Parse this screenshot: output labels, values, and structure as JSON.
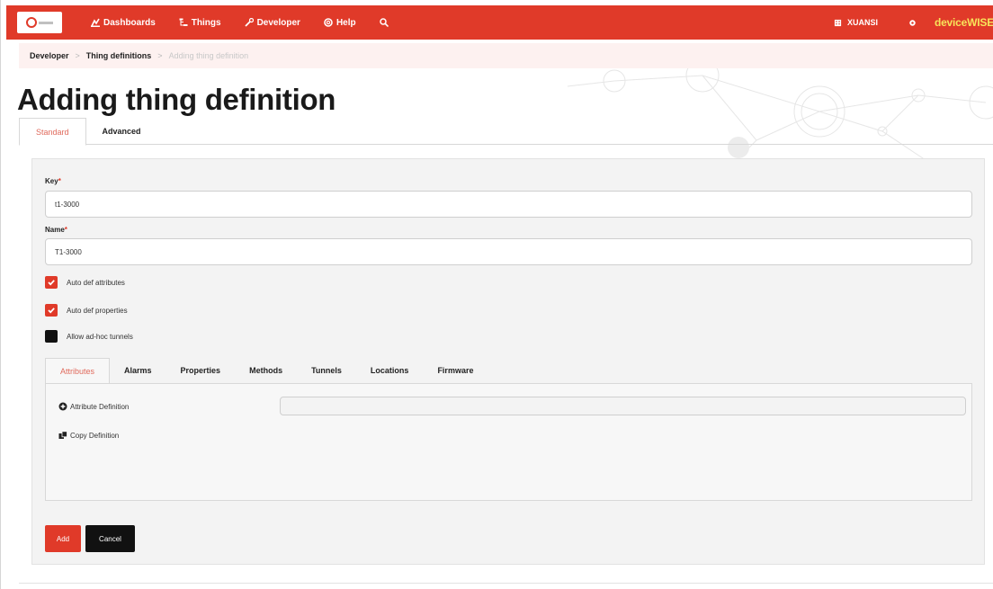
{
  "nav": {
    "items": [
      {
        "label": "Dashboards",
        "icon": "chart-icon"
      },
      {
        "label": "Things",
        "icon": "sitemap-icon"
      },
      {
        "label": "Developer",
        "icon": "wrench-icon"
      },
      {
        "label": "Help",
        "icon": "help-icon"
      }
    ],
    "search_icon": "search-icon",
    "user_label": "XUANSI",
    "settings_icon": "gear-icon",
    "brand_part1": "device",
    "brand_part2": "WISE"
  },
  "breadcrumb": [
    "Developer",
    "Thing definitions",
    "Adding thing definition"
  ],
  "page_title": "Adding thing definition",
  "top_tabs": [
    {
      "label": "Standard",
      "active": true
    },
    {
      "label": "Advanced",
      "active": false
    }
  ],
  "form": {
    "key_label": "Key",
    "key_value": "t1-3000",
    "name_label": "Name",
    "name_value": "T1-3000",
    "required_mark": "*",
    "checkboxes": [
      {
        "label": "Auto def attributes",
        "checked": true
      },
      {
        "label": "Auto def properties",
        "checked": true
      },
      {
        "label": "Allow ad-hoc tunnels",
        "checked": false
      }
    ]
  },
  "inner_tabs": [
    {
      "label": "Attributes",
      "active": true
    },
    {
      "label": "Alarms",
      "active": false
    },
    {
      "label": "Properties",
      "active": false
    },
    {
      "label": "Methods",
      "active": false
    },
    {
      "label": "Tunnels",
      "active": false
    },
    {
      "label": "Locations",
      "active": false
    },
    {
      "label": "Firmware",
      "active": false
    }
  ],
  "attributes_panel": {
    "add_label": "Attribute Definition",
    "copy_label": "Copy Definition"
  },
  "buttons": {
    "add": "Add",
    "cancel": "Cancel"
  },
  "colors": {
    "accent": "#e03a29",
    "active_tab_text": "#e06a5c",
    "brand": "#f7e35a"
  }
}
